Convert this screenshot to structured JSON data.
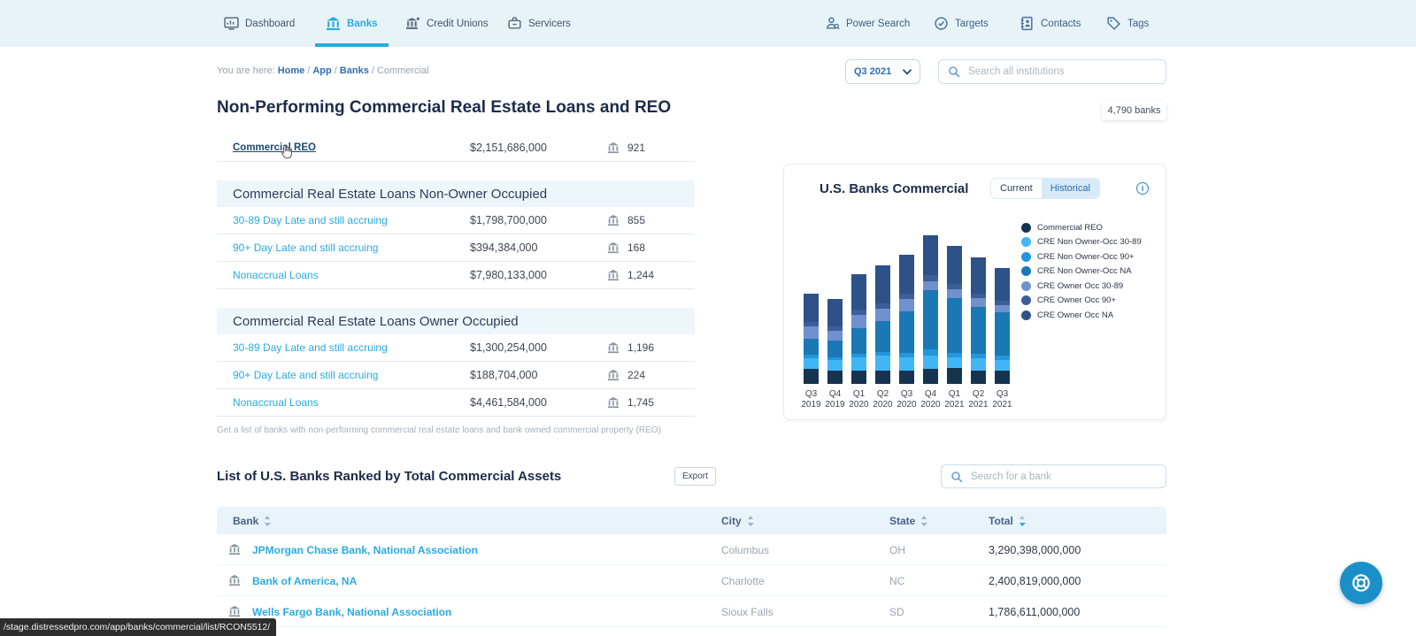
{
  "nav": {
    "left_items": [
      {
        "label": "Dashboard",
        "icon": "dashboard-icon",
        "active": false
      },
      {
        "label": "Banks",
        "icon": "bank-icon",
        "active": true
      },
      {
        "label": "Credit Unions",
        "icon": "credit-union-icon",
        "active": false
      },
      {
        "label": "Servicers",
        "icon": "briefcase-icon",
        "active": false
      }
    ],
    "right_items": [
      {
        "label": "Power Search",
        "icon": "person-search-icon"
      },
      {
        "label": "Targets",
        "icon": "target-icon"
      },
      {
        "label": "Contacts",
        "icon": "address-book-icon"
      },
      {
        "label": "Tags",
        "icon": "tag-icon"
      }
    ]
  },
  "breadcrumb": {
    "prefix": "You are here:",
    "links": [
      "Home",
      "App",
      "Banks"
    ],
    "current": "Commercial"
  },
  "quarter_select": {
    "value": "Q3 2021"
  },
  "search_institutions": {
    "placeholder": "Search all institutions"
  },
  "page": {
    "title": "Non-Performing Commercial Real Estate Loans and REO",
    "banks_count": "4,790 banks"
  },
  "metrics": {
    "reo_row": {
      "label": "Commercial REO",
      "amount": "$2,151,686,000",
      "count": "921"
    },
    "sections": [
      {
        "header": "Commercial Real Estate Loans Non-Owner Occupied",
        "rows": [
          {
            "label": "30-89 Day Late and still accruing",
            "amount": "$1,798,700,000",
            "count": "855"
          },
          {
            "label": "90+ Day Late and still accruing",
            "amount": "$394,384,000",
            "count": "168"
          },
          {
            "label": "Nonaccrual Loans",
            "amount": "$7,980,133,000",
            "count": "1,244"
          }
        ]
      },
      {
        "header": "Commercial Real Estate Loans Owner Occupied",
        "rows": [
          {
            "label": "30-89 Day Late and still accruing",
            "amount": "$1,300,254,000",
            "count": "1,196"
          },
          {
            "label": "90+ Day Late and still accruing",
            "amount": "$188,704,000",
            "count": "224"
          },
          {
            "label": "Nonaccrual Loans",
            "amount": "$4,461,584,000",
            "count": "1,745"
          }
        ]
      }
    ],
    "footnote": "Get a list of banks with non-performing commercial real estate loans and bank owned commercial property (REO)"
  },
  "chart_card": {
    "title": "U.S. Banks Commercial",
    "toggle": {
      "options": [
        "Current",
        "Historical"
      ],
      "selected": "Historical"
    },
    "info_icon": "i"
  },
  "chart_data": {
    "type": "bar",
    "stacked": true,
    "title": "U.S. Banks Commercial",
    "categories": [
      "Q3 2019",
      "Q4 2019",
      "Q1 2020",
      "Q2 2020",
      "Q3 2020",
      "Q4 2020",
      "Q1 2021",
      "Q2 2021",
      "Q3 2021"
    ],
    "series": [
      {
        "name": "Commercial REO",
        "color": "#16344f",
        "values": [
          10,
          9,
          9,
          9,
          9,
          10,
          11,
          9,
          9
        ]
      },
      {
        "name": "CRE Non Owner-Occ 30-89",
        "color": "#41b6f7",
        "values": [
          7,
          7,
          9,
          10,
          9,
          9,
          7,
          8,
          7
        ]
      },
      {
        "name": "CRE Non Owner-Occ 90+",
        "color": "#2297dd",
        "values": [
          2.5,
          2,
          2.5,
          2.5,
          3,
          4,
          3,
          3,
          3
        ]
      },
      {
        "name": "CRE Non Owner-Occ NA",
        "color": "#1a78b4",
        "values": [
          11,
          11,
          17,
          21,
          28,
          40,
          37,
          32,
          29
        ]
      },
      {
        "name": "CRE Owner Occ 30-89",
        "color": "#7090ce",
        "values": [
          8,
          7,
          9,
          8,
          8,
          6,
          6,
          6,
          5
        ]
      },
      {
        "name": "CRE Owner Occ 90+",
        "color": "#3c5e99",
        "values": [
          3,
          3,
          3.5,
          3.5,
          4,
          4,
          3,
          3,
          3
        ]
      },
      {
        "name": "CRE Owner Occ NA",
        "color": "#2e5188",
        "values": [
          19.5,
          18,
          24,
          26,
          26,
          27,
          26,
          24,
          22
        ]
      }
    ],
    "ylim": [
      0,
      100
    ],
    "y_axis_shown": false,
    "grid": false,
    "legend_position": "right",
    "note": "values are relative units estimated from bar heights; no numeric axis shown"
  },
  "bank_list": {
    "title": "List of U.S. Banks Ranked by Total Commercial Assets",
    "export_label": "Export",
    "search_placeholder": "Search for a bank",
    "columns": [
      "Bank",
      "City",
      "State",
      "Total"
    ],
    "sorted_column": "Total",
    "rows": [
      {
        "bank": "JPMorgan Chase Bank, National Association",
        "city": "Columbus",
        "state": "OH",
        "total": "3,290,398,000,000"
      },
      {
        "bank": "Bank of America, NA",
        "city": "Charlotte",
        "state": "NC",
        "total": "2,400,819,000,000"
      },
      {
        "bank": "Wells Fargo Bank, National Association",
        "city": "Sioux Falls",
        "state": "SD",
        "total": "1,786,611,000,000"
      }
    ]
  },
  "status_bar": {
    "url": "/stage.distressedpro.com/app/banks/commercial/list/RCON5512/"
  },
  "colors": {
    "accent": "#29abe2",
    "nav_bg": "#e8f3f8",
    "dark_navy_text": "#1c2b4a",
    "help_fab": "#1b90c8"
  }
}
